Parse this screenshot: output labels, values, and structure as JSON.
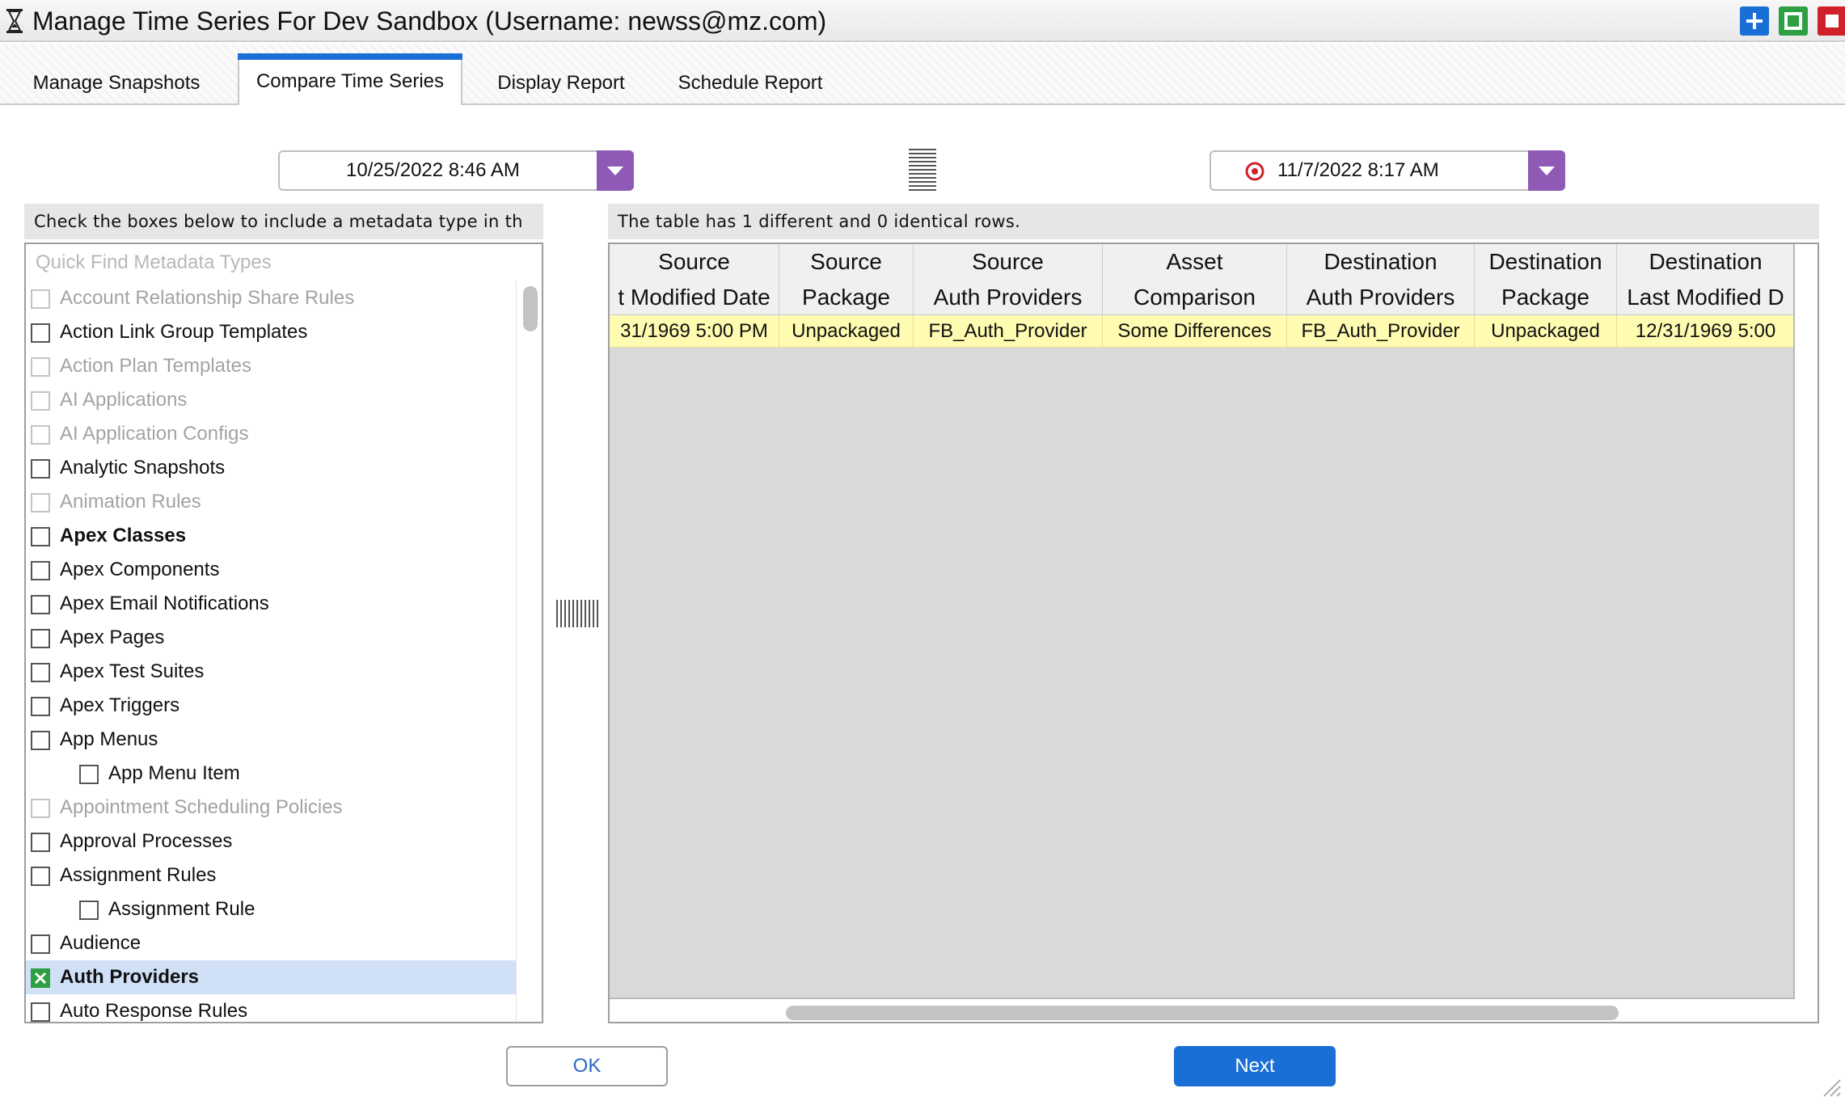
{
  "window": {
    "title": "Manage Time Series For Dev Sandbox (Username: newss@mz.com)"
  },
  "tabs": [
    {
      "label": "Manage Snapshots",
      "active": false
    },
    {
      "label": "Compare Time Series",
      "active": true
    },
    {
      "label": "Display Report",
      "active": false
    },
    {
      "label": "Schedule Report",
      "active": false
    }
  ],
  "dates": {
    "source": "10/25/2022 8:46 AM",
    "destination": "11/7/2022 8:17 AM"
  },
  "left_panel": {
    "hint": "Check the boxes below to include a metadata type in th",
    "quick_find_placeholder": "Quick Find Metadata Types",
    "items": [
      {
        "label": "Account Relationship Share Rules",
        "state": "disabled"
      },
      {
        "label": "Action Link Group Templates",
        "state": "normal"
      },
      {
        "label": "Action Plan Templates",
        "state": "disabled"
      },
      {
        "label": "AI Applications",
        "state": "disabled"
      },
      {
        "label": "AI Application Configs",
        "state": "disabled"
      },
      {
        "label": "Analytic Snapshots",
        "state": "normal"
      },
      {
        "label": "Animation Rules",
        "state": "disabled"
      },
      {
        "label": "Apex Classes",
        "state": "bold"
      },
      {
        "label": "Apex Components",
        "state": "normal"
      },
      {
        "label": "Apex Email Notifications",
        "state": "normal"
      },
      {
        "label": "Apex Pages",
        "state": "normal"
      },
      {
        "label": "Apex Test Suites",
        "state": "normal"
      },
      {
        "label": "Apex Triggers",
        "state": "normal"
      },
      {
        "label": "App Menus",
        "state": "normal"
      },
      {
        "label": "App Menu Item",
        "state": "child"
      },
      {
        "label": "Appointment Scheduling Policies",
        "state": "disabled"
      },
      {
        "label": "Approval Processes",
        "state": "normal"
      },
      {
        "label": "Assignment Rules",
        "state": "normal"
      },
      {
        "label": "Assignment Rule",
        "state": "child"
      },
      {
        "label": "Audience",
        "state": "normal"
      },
      {
        "label": "Auth Providers",
        "state": "selected"
      },
      {
        "label": "Auto Response Rules",
        "state": "normal"
      }
    ]
  },
  "right_panel": {
    "summary": "The table has 1 different and 0 identical rows.",
    "columns": [
      {
        "h1": "Source",
        "h2": "t Modified Date",
        "value": "31/1969 5:00 PM"
      },
      {
        "h1": "Source",
        "h2": "Package",
        "value": "Unpackaged"
      },
      {
        "h1": "Source",
        "h2": "Auth Providers",
        "value": "FB_Auth_Provider"
      },
      {
        "h1": "Asset",
        "h2": "Comparison",
        "value": "Some Differences"
      },
      {
        "h1": "Destination",
        "h2": "Auth Providers",
        "value": "FB_Auth_Provider"
      },
      {
        "h1": "Destination",
        "h2": "Package",
        "value": "Unpackaged"
      },
      {
        "h1": "Destination",
        "h2": "Last Modified D",
        "value": "12/31/1969 5:00"
      }
    ]
  },
  "buttons": {
    "ok": "OK",
    "next": "Next"
  },
  "colors": {
    "accent": "#1a6fd6",
    "dropdown": "#8e5ab5",
    "diff_row": "#fffbb0",
    "selected_row": "#cfe0f7"
  }
}
